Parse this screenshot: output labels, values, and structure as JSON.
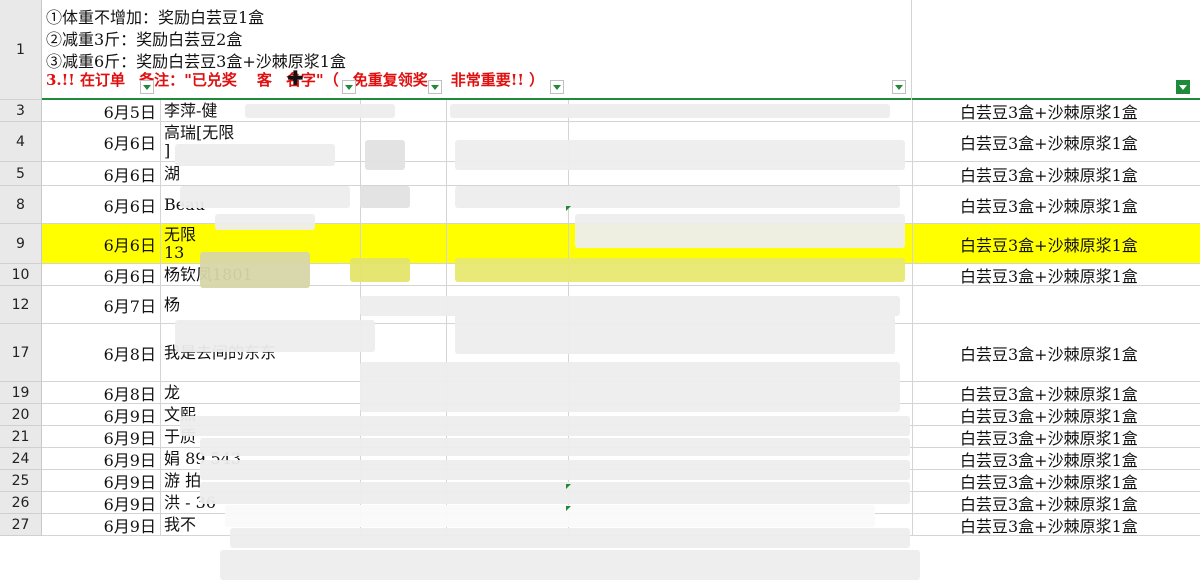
{
  "header_row": {
    "row_number": "1",
    "lines": [
      "①体重不增加：奖励白芸豆1盒",
      "②减重3斤：奖励白芸豆2盒",
      "③减重6斤：奖励白芸豆3盒+沙棘原浆1盒"
    ],
    "note_parts": [
      "3.!! 在订单",
      "备注：\"已兑奖",
      "客",
      "名字\"（",
      "免重复领奖，",
      "非常重要!! ）"
    ]
  },
  "colors": {
    "highlight": "#ffff00",
    "note": "#e01010",
    "filter": "#1f8a3a"
  },
  "icons": {
    "filter_dropdown": "chevron-down-icon",
    "active_filter": "funnel-icon",
    "cursor": "cross-cursor-icon"
  },
  "rows": [
    {
      "num": "3",
      "date": "6月5日",
      "name": [
        "李萍-健"
      ],
      "prize": "白芸豆3盒+沙棘原浆1盒"
    },
    {
      "num": "4",
      "date": "6月6日",
      "name": [
        "高瑞[无限",
        "]"
      ],
      "prize": "白芸豆3盒+沙棘原浆1盒"
    },
    {
      "num": "5",
      "date": "6月6日",
      "name": [
        "湖"
      ],
      "prize": "白芸豆3盒+沙棘原浆1盒"
    },
    {
      "num": "8",
      "date": "6月6日",
      "name": [
        "Beau"
      ],
      "prize": "白芸豆3盒+沙棘原浆1盒"
    },
    {
      "num": "9",
      "date": "6月6日",
      "name": [
        "无限",
        "13"
      ],
      "prize": "白芸豆3盒+沙棘原浆1盒",
      "highlight": true
    },
    {
      "num": "10",
      "date": "6月6日",
      "name": [
        "杨钦凤1801"
      ],
      "prize": "白芸豆3盒+沙棘原浆1盒"
    },
    {
      "num": "12",
      "date": "6月7日",
      "name": [
        "杨"
      ],
      "prize": ""
    },
    {
      "num": "17",
      "date": "6月8日",
      "name": [
        "我是去间的东东"
      ],
      "prize": "白芸豆3盒+沙棘原浆1盒"
    },
    {
      "num": "19",
      "date": "6月8日",
      "name": [
        "龙"
      ],
      "prize": "白芸豆3盒+沙棘原浆1盒"
    },
    {
      "num": "20",
      "date": "6月9日",
      "name": [
        "文熙"
      ],
      "prize": "白芸豆3盒+沙棘原浆1盒"
    },
    {
      "num": "21",
      "date": "6月9日",
      "name": [
        "于质"
      ],
      "prize": "白芸豆3盒+沙棘原浆1盒"
    },
    {
      "num": "24",
      "date": "6月9日",
      "name": [
        "娟   89  543"
      ],
      "prize": "白芸豆3盒+沙棘原浆1盒"
    },
    {
      "num": "25",
      "date": "6月9日",
      "name": [
        "游  拍"
      ],
      "prize": "白芸豆3盒+沙棘原浆1盒"
    },
    {
      "num": "26",
      "date": "6月9日",
      "name": [
        "洪  -   36"
      ],
      "prize": "白芸豆3盒+沙棘原浆1盒"
    },
    {
      "num": "27",
      "date": "6月9日",
      "name": [
        "我不"
      ],
      "prize": "白芸豆3盒+沙棘原浆1盒"
    }
  ]
}
